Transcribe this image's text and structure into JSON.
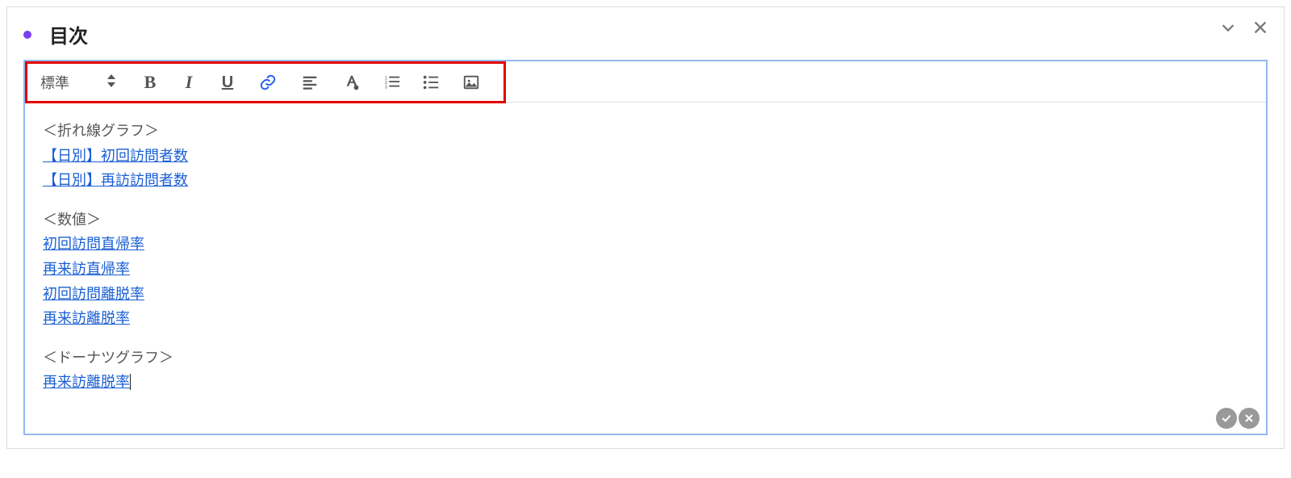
{
  "panel": {
    "title": "目次"
  },
  "toolbar": {
    "style": "標準"
  },
  "content": {
    "groups": [
      {
        "heading": "＜折れ線グラフ＞",
        "links": [
          "【日別】初回訪問者数",
          "【日別】再訪訪問者数"
        ]
      },
      {
        "heading": "＜数値＞",
        "links": [
          "初回訪問直帰率",
          "再来訪直帰率",
          "初回訪問離脱率",
          "再来訪離脱率"
        ]
      },
      {
        "heading": "＜ドーナツグラフ＞",
        "links": [
          "再来訪離脱率"
        ]
      }
    ]
  }
}
